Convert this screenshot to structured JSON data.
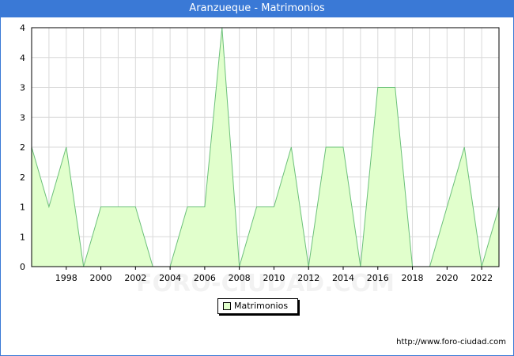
{
  "header": {
    "title": "Aranzueque - Matrimonios"
  },
  "footer": {
    "credit": "http://www.foro-ciudad.com"
  },
  "watermark": "FORO-CIUDAD.COM",
  "colors": {
    "title_bar": "#3a79d6",
    "area_fill": "#e1ffcc",
    "area_line": "#6cc07a",
    "grid": "#d9d9d9"
  },
  "chart_data": {
    "type": "area",
    "title": "Aranzueque - Matrimonios",
    "x_ticks": [
      "1998",
      "2000",
      "2002",
      "2004",
      "2006",
      "2008",
      "2010",
      "2012",
      "2014",
      "2016",
      "2018",
      "2020",
      "2022"
    ],
    "y_ticks": [
      "0",
      "1",
      "1",
      "2",
      "2",
      "3",
      "3",
      "4",
      "4"
    ],
    "ylim": [
      0,
      4
    ],
    "xlim": [
      1996,
      2023
    ],
    "grid": true,
    "legend": {
      "position": "bottom-center",
      "entries": [
        "Matrimonios"
      ]
    },
    "series": [
      {
        "name": "Matrimonios",
        "x": [
          1996,
          1997,
          1998,
          1999,
          2000,
          2001,
          2002,
          2003,
          2004,
          2005,
          2006,
          2007,
          2008,
          2009,
          2010,
          2011,
          2012,
          2013,
          2014,
          2015,
          2016,
          2017,
          2018,
          2019,
          2020,
          2021,
          2022,
          2023
        ],
        "values": [
          2,
          1,
          2,
          0,
          1,
          1,
          1,
          0,
          0,
          1,
          1,
          4,
          0,
          1,
          1,
          2,
          0,
          2,
          2,
          0,
          3,
          3,
          0,
          0,
          1,
          2,
          0,
          1
        ]
      }
    ]
  }
}
